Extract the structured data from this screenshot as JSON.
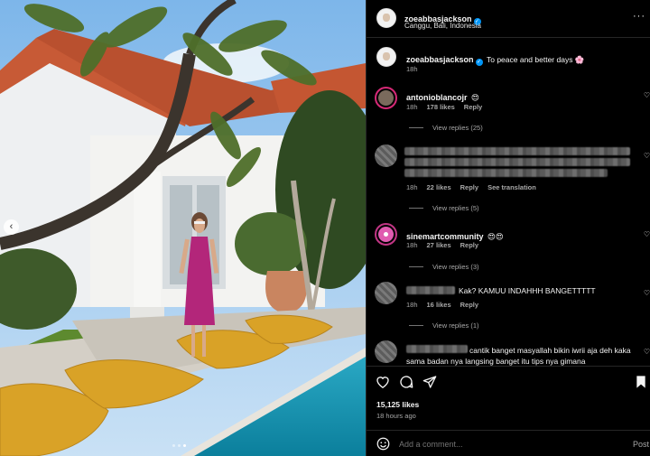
{
  "post": {
    "username": "zoeabbasjackson",
    "location": "Canggu, Bali, Indonesia",
    "more_label": "···",
    "caption": "To peace and better days 🌸",
    "caption_age": "18h",
    "likes": "15,125 likes",
    "posted_ago": "18 hours ago",
    "comment_placeholder": "Add a comment...",
    "post_label": "Post"
  },
  "comments": [
    {
      "username": "antonioblancojr",
      "text": "😍",
      "age": "18h",
      "likes": "178 likes",
      "reply": "Reply",
      "view_replies": "View replies (25)"
    },
    {
      "username": "",
      "text": "",
      "age": "18h",
      "likes": "22 likes",
      "reply": "Reply",
      "translate": "See translation",
      "view_replies": "View replies (5)"
    },
    {
      "username": "sinemartcommunity",
      "text": "😍😍",
      "age": "18h",
      "likes": "27 likes",
      "reply": "Reply",
      "view_replies": "View replies (3)"
    },
    {
      "username": "",
      "text": "Kak? KAMUU INDAHHH BANGETTTTT",
      "age": "18h",
      "likes": "16 likes",
      "reply": "Reply",
      "view_replies": "View replies (1)"
    },
    {
      "username": "",
      "text": "cantik banget masyallah bikin iwrii aja deh kaka sama badan nya langsing banget itu tips nya gimana"
    }
  ],
  "icons": {
    "heart": "heart-icon",
    "comment": "comment-icon",
    "share": "share-icon",
    "save": "bookmark-icon",
    "emoji": "emoji-icon",
    "prev": "chevron-left-icon"
  },
  "colors": {
    "background": "#000000",
    "verified": "#0095f6",
    "secondary_text": "#a8a8a8",
    "divider": "#262626"
  }
}
